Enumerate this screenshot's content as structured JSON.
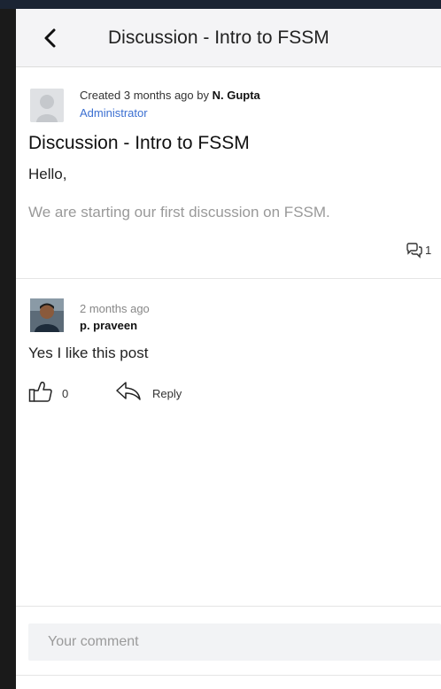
{
  "header": {
    "title": "Discussion - Intro to FSSM",
    "back_icon": "chevron-left-icon"
  },
  "post": {
    "created_prefix": "Created 3 months ago by ",
    "author": "N. Gupta",
    "role": "Administrator",
    "title": "Discussion - Intro to FSSM",
    "greeting": "Hello,",
    "body": "We are starting our first discussion on FSSM.",
    "comment_count": "1",
    "comment_icon": "comments-icon"
  },
  "comment": {
    "time": "2 months ago",
    "author": "p. praveen",
    "text": "Yes I like this post",
    "like_count": "0",
    "like_icon": "thumbs-up-icon",
    "reply_icon": "reply-icon",
    "reply_label": "Reply"
  },
  "composer": {
    "placeholder": "Your comment"
  },
  "colors": {
    "accent": "#3b6fd1",
    "header_bg": "#f4f4f6",
    "muted_text": "#999999"
  }
}
